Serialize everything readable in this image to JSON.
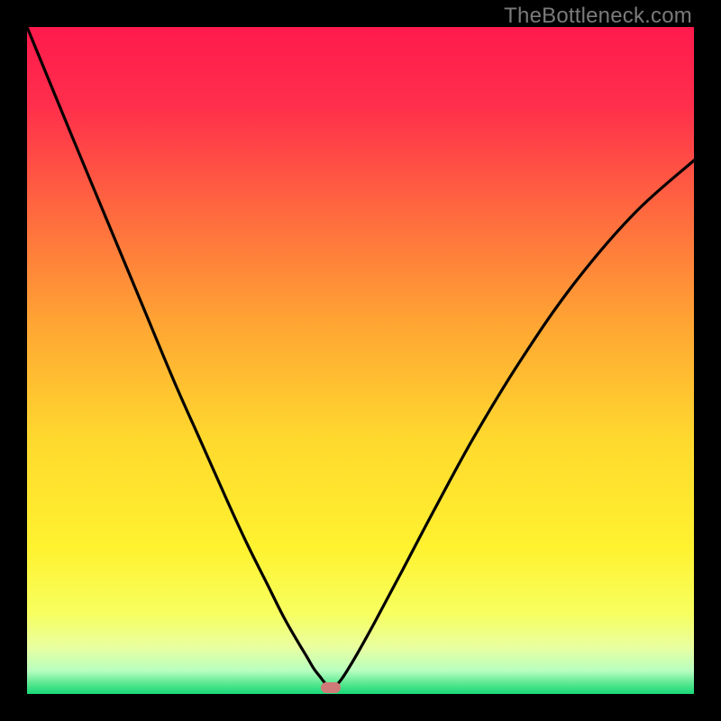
{
  "watermark": "TheBottleneck.com",
  "colors": {
    "black": "#000000",
    "curve": "#000000",
    "marker": "#cf7a78",
    "watermark": "#7a7a7a"
  },
  "gradient_stops": [
    {
      "pos": 0.0,
      "color": "#ff1a4d"
    },
    {
      "pos": 0.12,
      "color": "#ff2f4b"
    },
    {
      "pos": 0.28,
      "color": "#ff6a3f"
    },
    {
      "pos": 0.45,
      "color": "#ffa733"
    },
    {
      "pos": 0.62,
      "color": "#ffd92e"
    },
    {
      "pos": 0.78,
      "color": "#fff22f"
    },
    {
      "pos": 0.88,
      "color": "#f7ff60"
    },
    {
      "pos": 0.93,
      "color": "#e9ffa0"
    },
    {
      "pos": 0.965,
      "color": "#b8ffc0"
    },
    {
      "pos": 0.985,
      "color": "#57e68f"
    },
    {
      "pos": 1.0,
      "color": "#17d977"
    }
  ],
  "chart_data": {
    "type": "line",
    "title": "",
    "xlabel": "",
    "ylabel": "",
    "xlim": [
      0,
      1
    ],
    "ylim": [
      0,
      1
    ],
    "grid": false,
    "legend": false,
    "annotations": [],
    "series": [
      {
        "name": "curve",
        "x": [
          0.0,
          0.07,
          0.12,
          0.17,
          0.22,
          0.26,
          0.3,
          0.33,
          0.36,
          0.385,
          0.405,
          0.42,
          0.43,
          0.44,
          0.448,
          0.455,
          0.462,
          0.47,
          0.48,
          0.495,
          0.52,
          0.56,
          0.61,
          0.67,
          0.74,
          0.82,
          0.91,
          1.0
        ],
        "y": [
          1.0,
          0.83,
          0.71,
          0.59,
          0.47,
          0.38,
          0.29,
          0.225,
          0.165,
          0.115,
          0.08,
          0.055,
          0.038,
          0.025,
          0.015,
          0.01,
          0.012,
          0.02,
          0.035,
          0.06,
          0.105,
          0.18,
          0.275,
          0.385,
          0.5,
          0.615,
          0.72,
          0.8
        ]
      }
    ],
    "marker": {
      "x": 0.455,
      "y": 0.01
    }
  }
}
